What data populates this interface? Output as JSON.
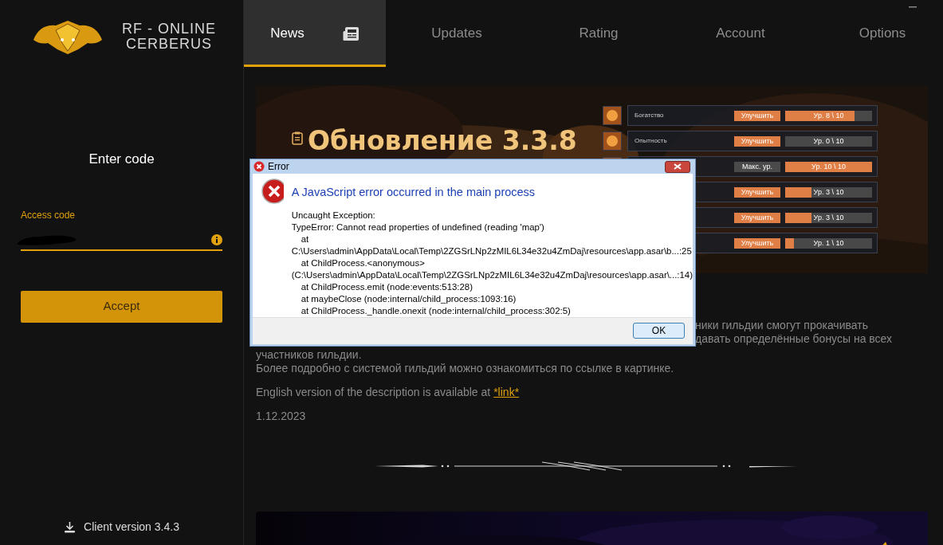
{
  "brand": {
    "lines": [
      "RF - ONLINE",
      "CERBERUS"
    ]
  },
  "tabs": [
    {
      "label": "News",
      "selected": true,
      "kind": "icon"
    },
    {
      "label": "Updates",
      "selected": false,
      "kind": "plain"
    },
    {
      "label": "Rating",
      "selected": false,
      "kind": "plain"
    },
    {
      "label": "Account",
      "selected": false,
      "kind": "plain"
    },
    {
      "label": "Options",
      "selected": false,
      "kind": "plain"
    }
  ],
  "login": {
    "title": "Enter code",
    "field_label": "Access code",
    "button": "Accept",
    "client_version": "Client version 3.4.3"
  },
  "news": {
    "banner": {
      "title": "Обновление 3.3.8",
      "rows": [
        {
          "name": "Богатство",
          "icon": true,
          "action": "Улучшить",
          "kind": "upgrade",
          "level": 0.8,
          "reading": "Ур. 8 \\ 10"
        },
        {
          "name": "Опытность",
          "icon": true,
          "action": "Улучшить",
          "kind": "upgrade",
          "level": 0,
          "reading": "Ур. 0 \\ 10"
        },
        {
          "icon": true,
          "action": "Макс. ур.",
          "kind": "max",
          "level": 1,
          "reading": "Ур. 10 \\ 10"
        },
        {
          "action": "Улучшить",
          "kind": "upgrade",
          "level": 0.3,
          "reading": "Ур. 3 \\ 10",
          "icon": false
        },
        {
          "icon": false,
          "action": "Улучшить",
          "kind": "upgrade",
          "level": 0.3,
          "reading": "Ур. 3 \\ 10"
        },
        {
          "icon": false,
          "action": "Улучшить",
          "kind": "upgrade",
          "level": 0.1,
          "reading": "Ур. 1 \\ 10"
        }
      ]
    },
    "partial_lines": [
      "ники гильдии смогут прокачивать",
      "давать определённые бонусы на всех"
    ],
    "lines": [
      "участников гильдии.",
      "Более подробно с системой гильдий можно ознакомиться по ссылке в картинке."
    ],
    "english_note": "English version of the description is available at",
    "link": "*link*",
    "date": "1.12.2023"
  },
  "dialog": {
    "title": "Error",
    "heading": "A JavaScript error occurred in the main process",
    "lines": [
      {
        "text": "Uncaught Exception:",
        "indented": false
      },
      {
        "text": "TypeError: Cannot read properties of undefined (reading 'map')",
        "indented": false
      },
      {
        "text": "at",
        "indented": true
      },
      {
        "text": "C:\\Users\\admin\\AppData\\Local\\Temp\\2ZGSrLNp2zMIL6L34e32u4ZmDaj\\resources\\app.asar\\b...:25",
        "indented": false
      },
      {
        "text": "at ChildProcess.<anonymous>",
        "indented": true
      },
      {
        "text": "(C:\\Users\\admin\\AppData\\Local\\Temp\\2ZGSrLNp2zMIL6L34e32u4ZmDaj\\resources\\app.asar\\...:14)",
        "indented": false
      },
      {
        "text": "at ChildProcess.emit (node:events:513:28)",
        "indented": true
      },
      {
        "text": "at maybeClose (node:internal/child_process:1093:16)",
        "indented": true
      },
      {
        "text": "at ChildProcess._handle.onexit (node:internal/child_process:302:5)",
        "indented": true
      }
    ],
    "button": "OK"
  }
}
